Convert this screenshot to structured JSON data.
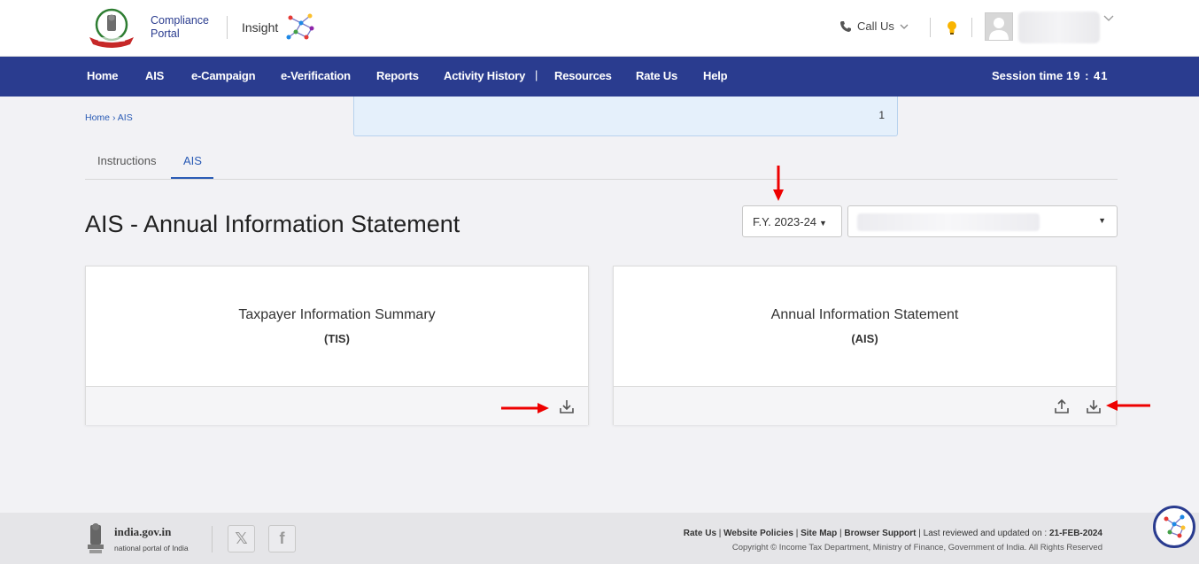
{
  "header": {
    "brand_line1": "Compliance",
    "brand_line2": "Portal",
    "insight_label": "Insight",
    "call_us": "Call Us",
    "accent_color": "#2a3c8f"
  },
  "nav": {
    "items": [
      "Home",
      "AIS",
      "e-Campaign",
      "e-Verification",
      "Reports",
      "Activity History",
      "Resources",
      "Rate Us",
      "Help"
    ],
    "separator": "|",
    "session_label": "Session time",
    "session_time": "19 : 41"
  },
  "breadcrumb": {
    "home": "Home",
    "separator": "›",
    "current": "AIS"
  },
  "notice": {
    "count": "1"
  },
  "tabs": {
    "instructions": "Instructions",
    "ais": "AIS",
    "active": "AIS"
  },
  "main": {
    "title": "AIS - Annual Information Statement",
    "fy_selected": "F.Y. 2023-24"
  },
  "cards": [
    {
      "title": "Taxpayer Information Summary",
      "subtitle": "(TIS)"
    },
    {
      "title": "Annual Information Statement",
      "subtitle": "(AIS)"
    }
  ],
  "footer": {
    "gov_name": "india.gov.in",
    "gov_sub": "national portal of India",
    "links": [
      "Rate Us",
      "Website Policies",
      "Site Map",
      "Browser Support"
    ],
    "reviewed_label": "Last reviewed and updated on :",
    "reviewed_date": "21-FEB-2024",
    "copyright": "Copyright © Income Tax Department, Ministry of Finance, Government of India. All Rights Reserved"
  },
  "icons": {
    "phone": "phone-icon",
    "bulb": "lightbulb-icon",
    "download": "download-icon",
    "upload": "upload-icon",
    "x_social": "x-twitter-icon",
    "facebook": "facebook-icon",
    "chatbot": "chatbot-icon"
  }
}
